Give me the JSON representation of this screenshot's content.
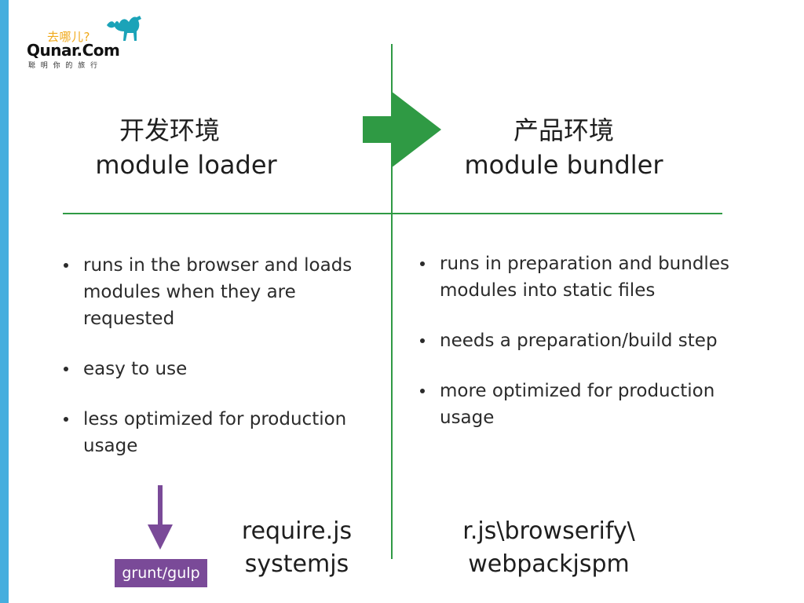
{
  "logo": {
    "tagline_cn": "去哪儿?",
    "brand": "Qunar.Com",
    "slogan": "聪明你的旅行"
  },
  "left_column": {
    "heading_cn": "开发环境",
    "heading_en": "module loader",
    "bullets": [
      "runs in the browser and loads modules when they are requested",
      "easy to use",
      "less optimized for production usage"
    ],
    "tools": [
      "require.js",
      "systemjs"
    ],
    "badge": "grunt/gulp"
  },
  "right_column": {
    "heading_cn": "产品环境",
    "heading_en": "module bundler",
    "bullets": [
      "runs in preparation and bundles modules into static files",
      "needs a preparation/build step",
      "more optimized for production usage"
    ],
    "tools": [
      "r.js\\browserify\\",
      "webpackjspm"
    ]
  },
  "colors": {
    "accent_stripe": "#45aede",
    "divider_green": "#2f9a44",
    "arrow_green": "#2f9a44",
    "badge_purple": "#7a4a98",
    "logo_orange": "#f0a91a",
    "camel_teal": "#1ba3b8"
  },
  "icons": {
    "big_arrow": "right-arrow-icon",
    "small_arrow": "down-arrow-icon",
    "logo_mark": "camel-icon"
  }
}
